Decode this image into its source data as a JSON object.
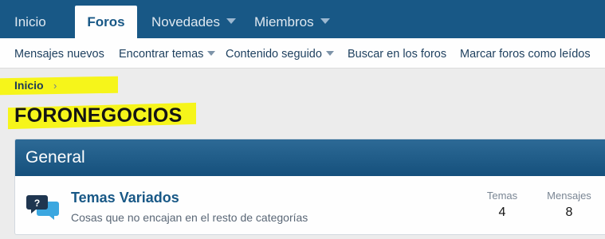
{
  "topnav": {
    "tabs": [
      {
        "label": "Inicio"
      },
      {
        "label": "Foros"
      },
      {
        "label": "Novedades"
      },
      {
        "label": "Miembros"
      }
    ]
  },
  "subnav": {
    "items": [
      {
        "label": "Mensajes nuevos"
      },
      {
        "label": "Encontrar temas"
      },
      {
        "label": "Contenido seguido"
      },
      {
        "label": "Buscar en los foros"
      },
      {
        "label": "Marcar foros como leídos"
      }
    ]
  },
  "breadcrumb": {
    "label": "Inicio"
  },
  "page": {
    "title": "FORONEGOCIOS"
  },
  "category": {
    "title": "General",
    "node": {
      "title": "Temas Variados",
      "description": "Cosas que no encajan en el resto de categorías",
      "stats": {
        "temas_label": "Temas",
        "temas_value": "4",
        "mensajes_label": "Mensajes",
        "mensajes_value": "8"
      }
    }
  },
  "colors": {
    "nav_bg": "#185886",
    "highlight": "#f6f51a",
    "link": "#185886"
  },
  "icons": [
    "chevron-down-icon",
    "chevron-right-icon",
    "chat-bubbles-icon"
  ]
}
